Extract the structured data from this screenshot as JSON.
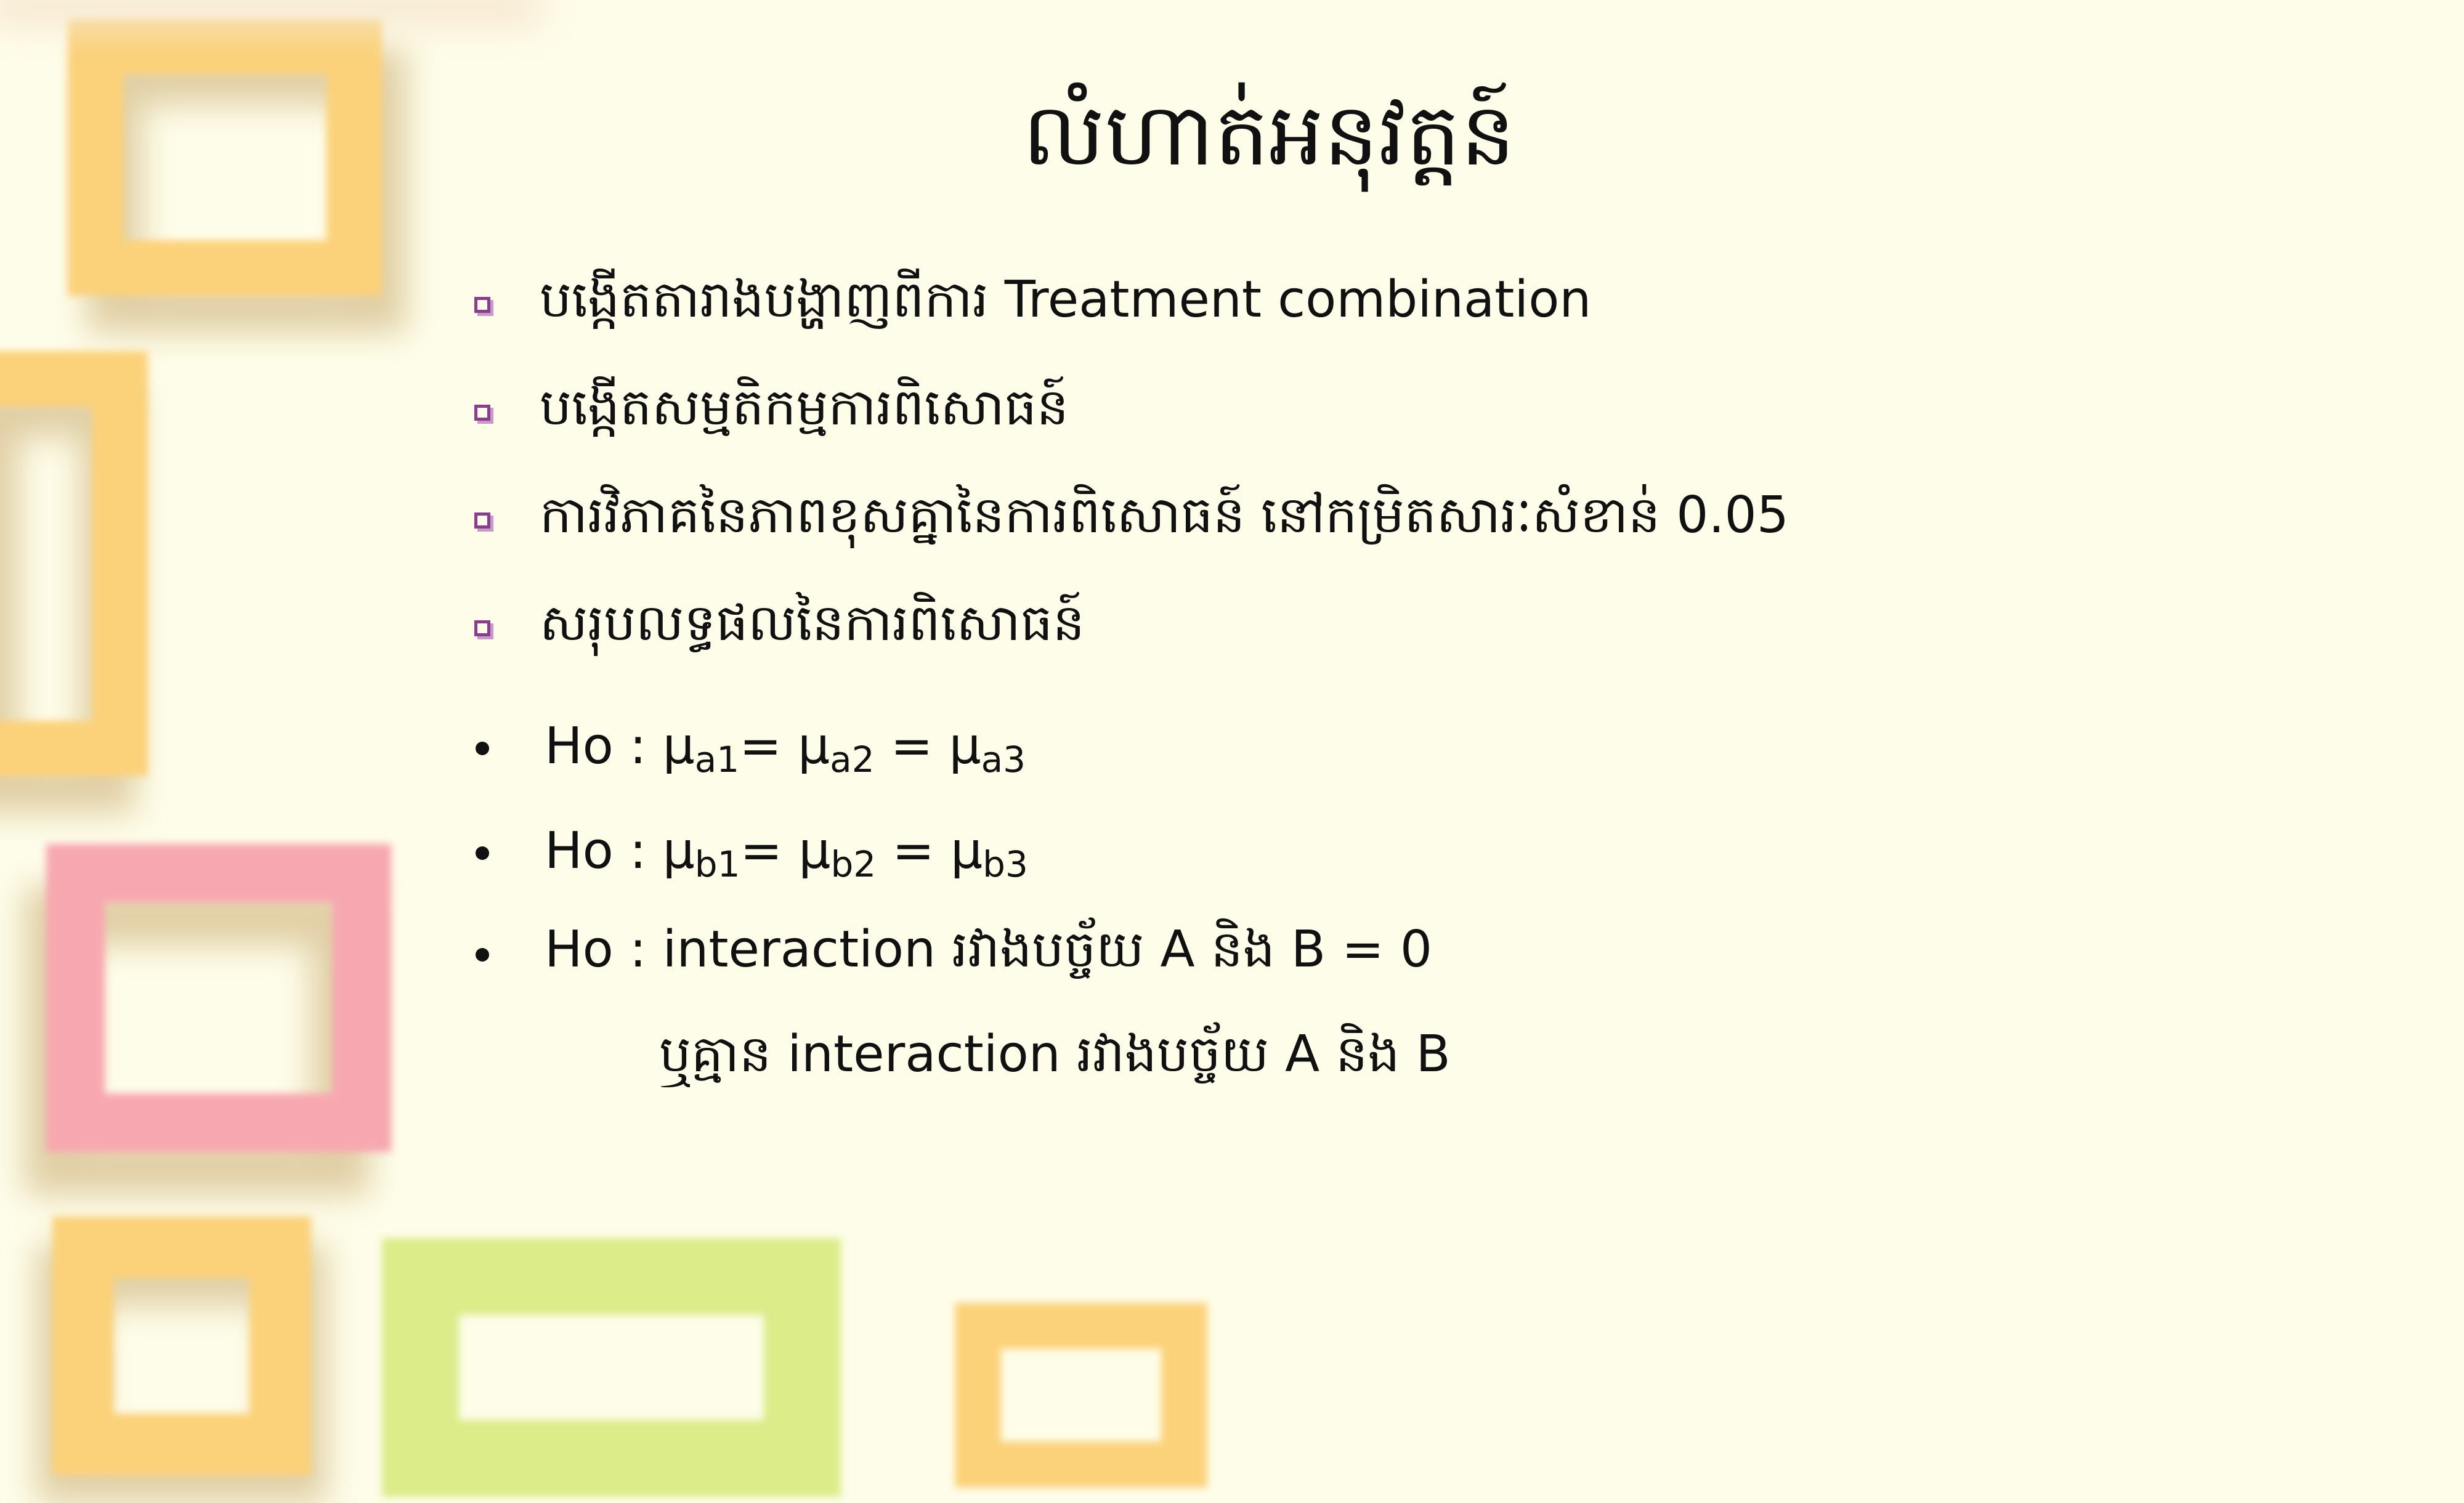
{
  "slide": {
    "title": "លំហាត់អនុវត្តន៍",
    "bullets": [
      "បង្កើតតារាងបង្ហាញពីការ Treatment combination",
      "បង្កើតសម្មតិកម្មការពិសោធន៍",
      "ការវិភាគនៃភាពខុសគ្នានៃការពិសោធន៍ នៅកម្រិតសារៈសំខាន់ 0.05",
      "សរុបលទ្ធផលនៃការពិសោធន៍"
    ],
    "hypotheses": {
      "h1": {
        "prefix": "Ho : ",
        "mu": "μ",
        "s1": "a1",
        "s2": "a2",
        "s3": "a3",
        "eq1": "= ",
        "eq2": " = "
      },
      "h2": {
        "prefix": "Ho : ",
        "mu": "μ",
        "s1": "b1",
        "s2": "b2",
        "s3": "b3",
        "eq1": "= ",
        "eq2": " = "
      },
      "h3": "Ho : interaction រវាងបច្ច័យ A និង B = 0",
      "h3_cont": "ឬគ្មាន interaction រវាងបច្ច័យ A និង B"
    }
  },
  "colors": {
    "background": "#fefde9",
    "frame_orange": "#fbd27a",
    "frame_pink": "#f7a7b0",
    "frame_green": "#dcec88",
    "bullet_square": "#8e3a8f"
  },
  "icons": {
    "bullet": "hollow-square-icon",
    "hypothesis_bullet": "dot-icon"
  }
}
